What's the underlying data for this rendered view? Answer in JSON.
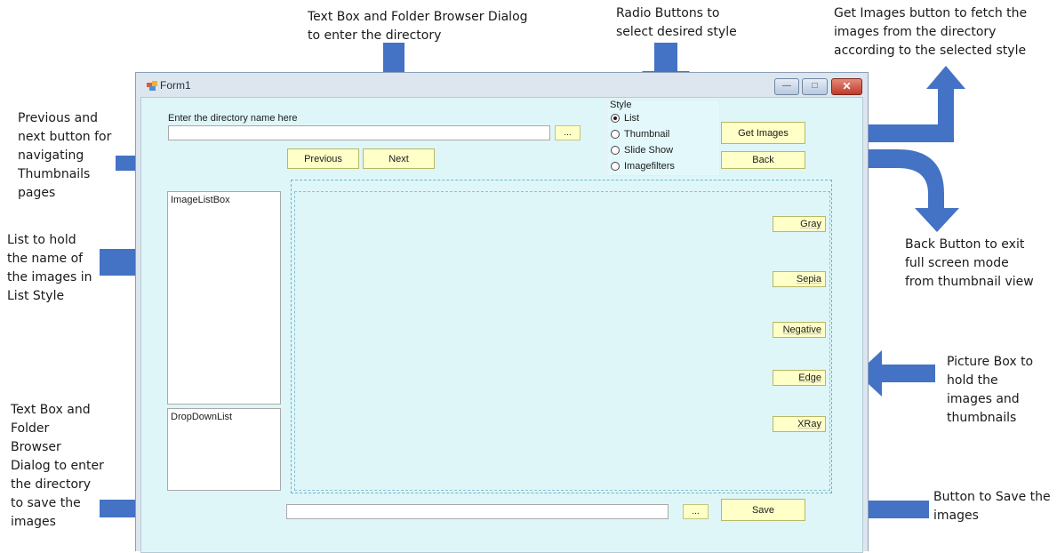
{
  "annotations": {
    "directory_dialog": [
      "Text Box and Folder Browser Dialog",
      "to enter the directory"
    ],
    "radio_buttons": [
      "Radio Buttons to",
      "select desired style"
    ],
    "get_images": [
      "Get Images button to fetch the",
      "images from the directory",
      "according to the selected style"
    ],
    "prev_next": [
      "Previous and",
      "next button for",
      "navigating",
      "Thumbnails",
      "pages"
    ],
    "list": [
      "List to hold",
      "the name of",
      "the images in",
      "List Style"
    ],
    "back": [
      "Back Button to exit",
      "full screen mode",
      "from thumbnail view"
    ],
    "picture_box": [
      "Picture Box to",
      "hold the",
      "images and",
      "thumbnails"
    ],
    "save_dialog": [
      "Text Box and",
      "Folder",
      "Browser",
      "Dialog to enter",
      "the directory",
      "to save the",
      "images"
    ],
    "save_button": [
      "Button to Save the",
      "images"
    ]
  },
  "window": {
    "title": "Form1",
    "controls": {
      "minimize": "—",
      "maximize": "□",
      "close": "✕"
    }
  },
  "form": {
    "directory_label": "Enter the directory name here",
    "directory_value": "",
    "browse_label": "...",
    "previous_label": "Previous",
    "next_label": "Next",
    "style_group": {
      "title": "Style",
      "options": [
        "List",
        "Thumbnail",
        "Slide Show",
        "Imagefilters"
      ],
      "selected": "List"
    },
    "get_images_label": "Get Images",
    "back_label": "Back",
    "image_listbox_label": "ImageListBox",
    "dropdown_label": "DropDownList",
    "filters": [
      "Gray",
      "Sepia",
      "Negative",
      "Edge",
      "XRay"
    ],
    "save_path_value": "",
    "save_browse_label": "...",
    "save_label": "Save"
  },
  "colors": {
    "arrow": "#4472C4",
    "client_bg": "#dff6f9",
    "button_bg": "#ffffc8",
    "close_button": "#c0392b"
  }
}
